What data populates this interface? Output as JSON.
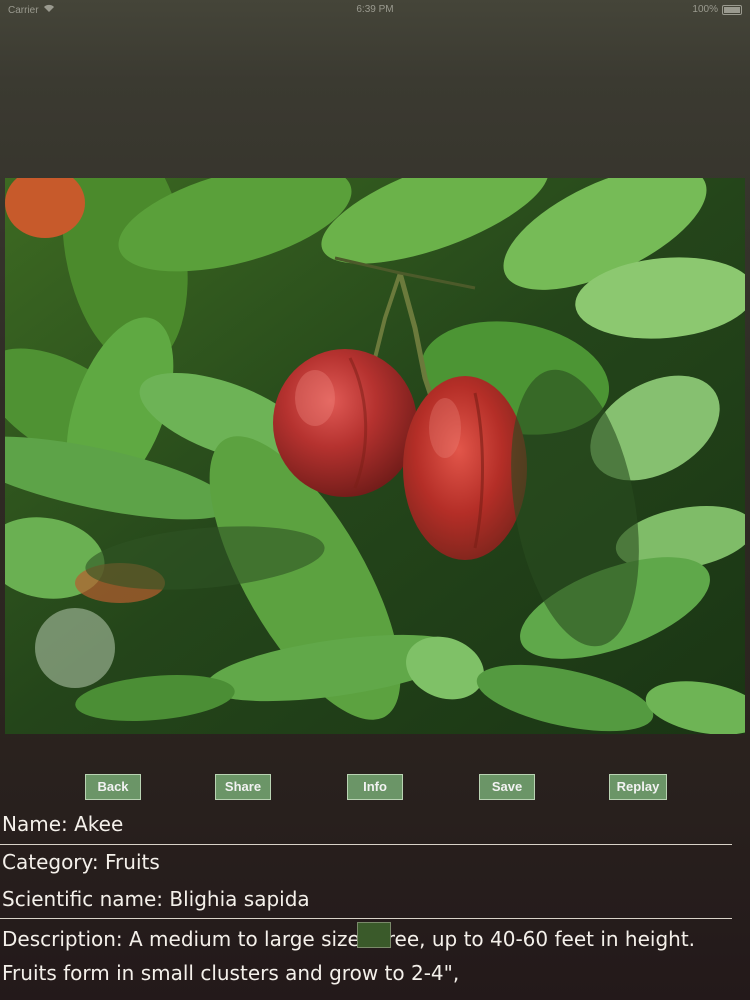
{
  "status_bar": {
    "carrier": "Carrier",
    "time": "6:39 PM",
    "battery": "100%"
  },
  "buttons": {
    "back": "Back",
    "share": "Share",
    "info": "Info",
    "save": "Save",
    "replay": "Replay"
  },
  "details": {
    "name": "Name: Akee",
    "category": "Category: Fruits",
    "scientific_name": "Scientific name: Blighia sapida",
    "description": "Description: A medium to large sized tree, up to 40-60 feet in height. Fruits form in small clusters and grow to 2-4\","
  },
  "colors": {
    "button_bg": "#6b9567",
    "button_border": "#b9d3b3",
    "text": "#f4f0ea",
    "background_dark": "#23191a"
  },
  "icons": {
    "wifi": "wifi-icon",
    "battery": "battery-icon"
  }
}
